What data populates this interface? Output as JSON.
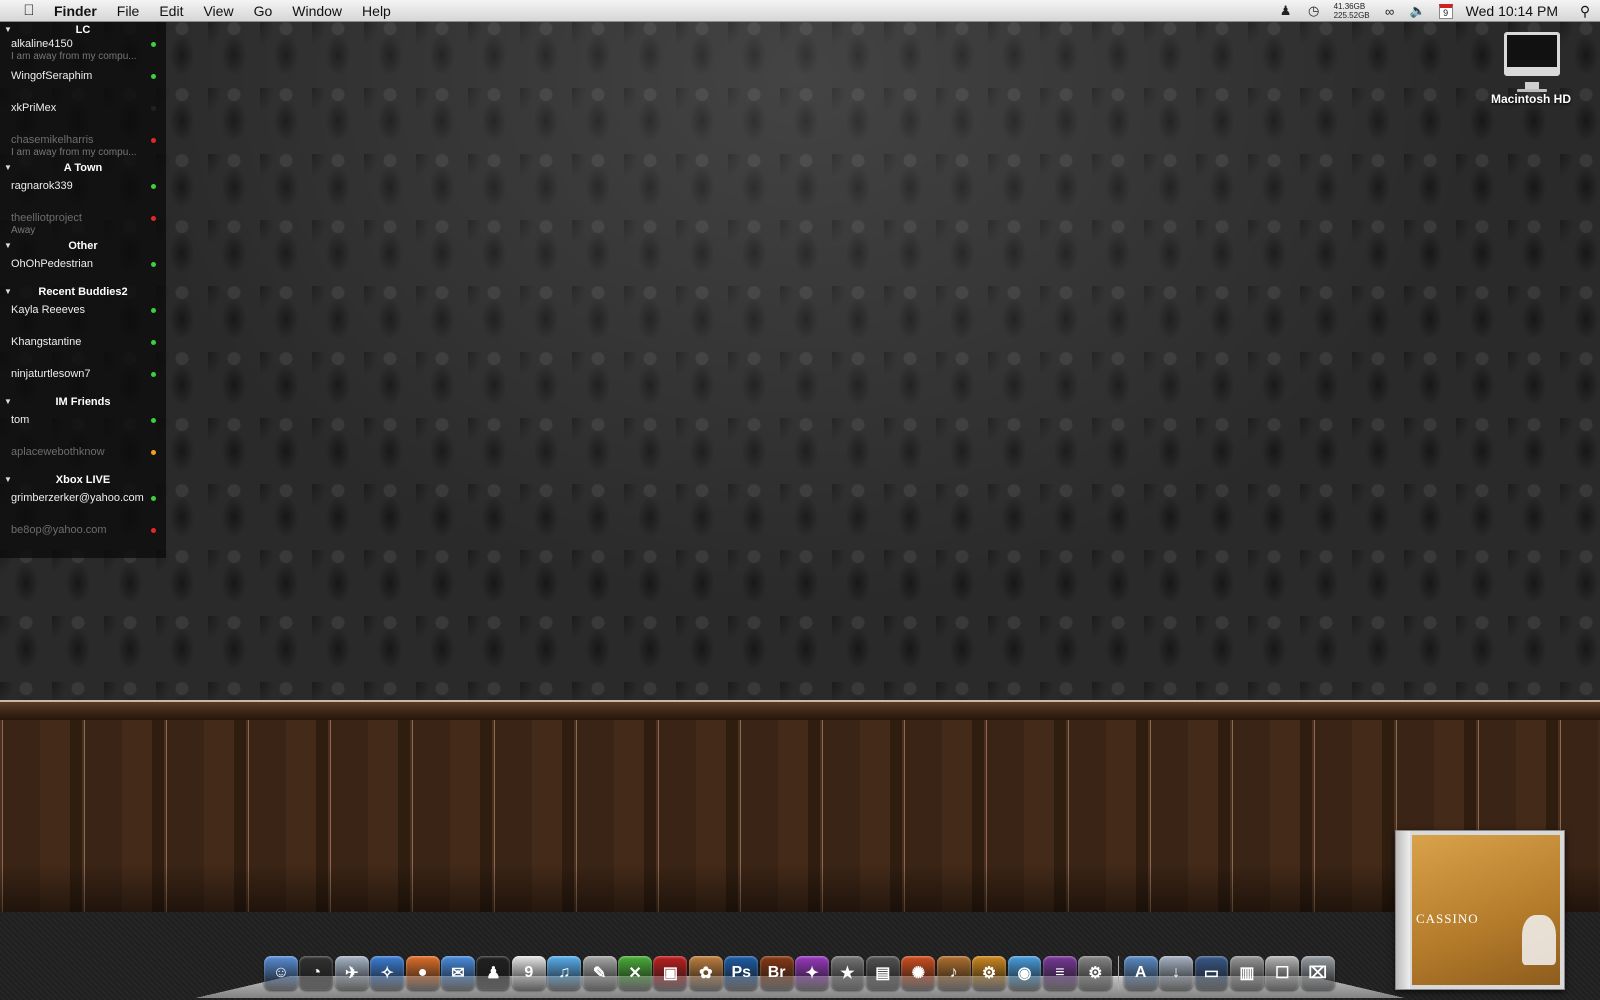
{
  "menubar": {
    "apple_icon": "apple-logo-icon",
    "app_name": "Finder",
    "menus": [
      "File",
      "Edit",
      "View",
      "Go",
      "Window",
      "Help"
    ],
    "disk_stats": [
      "41.36GB",
      "225.52GB"
    ],
    "calendar_day": "9",
    "clock": "Wed 10:14 PM"
  },
  "desktop": {
    "hd_label": "Macintosh HD"
  },
  "buddy_list": {
    "groups": [
      {
        "name": "LC",
        "buddies": [
          {
            "name": "alkaline4150",
            "status": "I am away from my compu...",
            "state": "available"
          },
          {
            "name": "WingofSeraphim",
            "status": "",
            "state": "available"
          },
          {
            "name": "xkPriMex",
            "status": "",
            "state": "none"
          },
          {
            "name": "chasemikelharris",
            "status": "I am away from my compu...",
            "state": "away"
          }
        ]
      },
      {
        "name": "A Town",
        "buddies": [
          {
            "name": "ragnarok339",
            "status": "",
            "state": "available"
          },
          {
            "name": "theelliotproject",
            "status": "Away",
            "state": "away"
          }
        ]
      },
      {
        "name": "Other",
        "buddies": [
          {
            "name": "OhOhPedestrian",
            "status": "",
            "state": "available"
          }
        ]
      },
      {
        "name": "Recent Buddies2",
        "buddies": [
          {
            "name": "Kayla Reeeves",
            "status": "",
            "state": "available"
          },
          {
            "name": "Khangstantine",
            "status": "",
            "state": "available"
          },
          {
            "name": "ninjaturtlesown7",
            "status": "",
            "state": "available"
          }
        ]
      },
      {
        "name": "IM Friends",
        "buddies": [
          {
            "name": "tom",
            "status": "",
            "state": "available"
          },
          {
            "name": "aplacewebothknow",
            "status": "",
            "state": "idle"
          }
        ]
      },
      {
        "name": "Xbox LIVE",
        "buddies": [
          {
            "name": "grimberzerker@yahoo.com",
            "status": "",
            "state": "available"
          },
          {
            "name": "be8op@yahoo.com",
            "status": "",
            "state": "away"
          }
        ]
      }
    ],
    "status_colors": {
      "available": "#3ecf3e",
      "away": "#e02828",
      "idle": "#f0a020",
      "none": "#222222"
    }
  },
  "album": {
    "title": "CASSINO"
  },
  "dock": {
    "apps": [
      {
        "name": "finder-icon",
        "glyph": "☺",
        "color": "#5a8fd8"
      },
      {
        "name": "dashboard-icon",
        "glyph": "◔",
        "color": "#333333"
      },
      {
        "name": "mail-icon",
        "glyph": "✈",
        "color": "#a9b7c9"
      },
      {
        "name": "safari-icon",
        "glyph": "✧",
        "color": "#3d7fd6"
      },
      {
        "name": "firefox-icon",
        "glyph": "●",
        "color": "#e0702a"
      },
      {
        "name": "ichat-icon",
        "glyph": "✉",
        "color": "#4a8ee0"
      },
      {
        "name": "adium-icon",
        "glyph": "♟",
        "color": "#222222"
      },
      {
        "name": "ical-icon",
        "glyph": "9",
        "color": "#e8e8e8"
      },
      {
        "name": "itunes-icon",
        "glyph": "♫",
        "color": "#5ab0f0"
      },
      {
        "name": "script-icon",
        "glyph": "✎",
        "color": "#aaaaaa"
      },
      {
        "name": "xbox-icon",
        "glyph": "✕",
        "color": "#4caf3a"
      },
      {
        "name": "photobooth-icon",
        "glyph": "▣",
        "color": "#c02020"
      },
      {
        "name": "iphoto-icon",
        "glyph": "✿",
        "color": "#c08040"
      },
      {
        "name": "photoshop-icon",
        "glyph": "Ps",
        "color": "#1e5ea8"
      },
      {
        "name": "bridge-icon",
        "glyph": "Br",
        "color": "#8a3a14"
      },
      {
        "name": "colorful-app-icon",
        "glyph": "✦",
        "color": "#9a3ac0"
      },
      {
        "name": "imovie-icon",
        "glyph": "★",
        "color": "#777777"
      },
      {
        "name": "clapper-icon",
        "glyph": "▤",
        "color": "#555555"
      },
      {
        "name": "ubuntu-icon",
        "glyph": "✺",
        "color": "#d05020"
      },
      {
        "name": "garageband-icon",
        "glyph": "♪",
        "color": "#b07030"
      },
      {
        "name": "gear-icon",
        "glyph": "⚙",
        "color": "#d08a20"
      },
      {
        "name": "network-icon",
        "glyph": "◉",
        "color": "#4aa0e0"
      },
      {
        "name": "dvd-player-icon",
        "glyph": "≡",
        "color": "#7a3a9a"
      },
      {
        "name": "system-preferences-icon",
        "glyph": "⚙",
        "color": "#888888"
      }
    ],
    "stacks": [
      {
        "name": "applications-folder-icon",
        "glyph": "A",
        "color": "#5c8ec8"
      },
      {
        "name": "downloads-folder-icon",
        "glyph": "↓",
        "color": "#a8b4c4"
      },
      {
        "name": "hard-drive-icon",
        "glyph": "▭",
        "color": "#3a5a8a"
      },
      {
        "name": "printer-icon",
        "glyph": "▥",
        "color": "#999999"
      },
      {
        "name": "documents-icon",
        "glyph": "☐",
        "color": "#b8b8b8"
      },
      {
        "name": "trash-icon",
        "glyph": "⌧",
        "color": "#9aa0a6"
      }
    ]
  }
}
